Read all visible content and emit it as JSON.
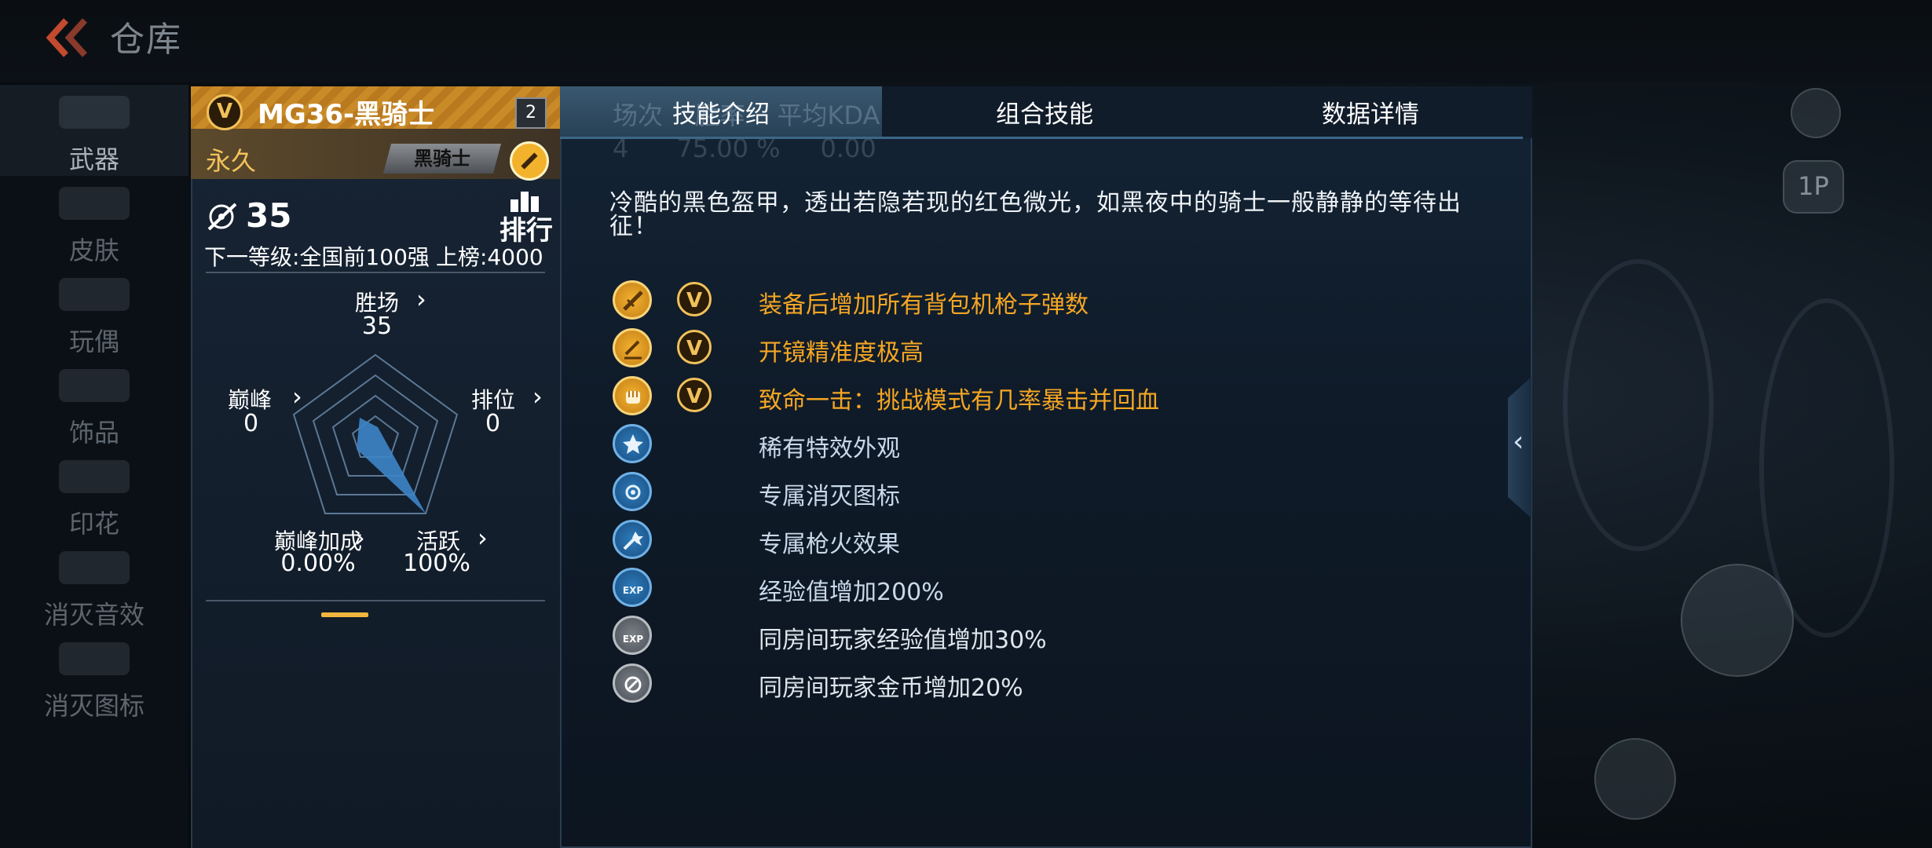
{
  "header": {
    "title": "仓库"
  },
  "nav": {
    "items": [
      {
        "label": "武器"
      },
      {
        "label": "皮肤"
      },
      {
        "label": "玩偶"
      },
      {
        "label": "饰品"
      },
      {
        "label": "印花"
      },
      {
        "label": "消灭音效"
      },
      {
        "label": "消灭图标"
      }
    ]
  },
  "weapon": {
    "name": "MG36-黑骑士",
    "badge_letter": "V",
    "level": "2",
    "duration": "永久",
    "tag": "黑骑士",
    "kill_count": "35",
    "rank_label": "排行",
    "next_level": "下一等级:全国前100强",
    "on_board": "上榜:4000"
  },
  "radar": {
    "top": {
      "label": "胜场",
      "value": "35"
    },
    "left": {
      "label": "巅峰",
      "value": "0"
    },
    "right": {
      "label": "排位",
      "value": "0"
    },
    "bottom_left": {
      "label": "巅峰加成",
      "value": "0.00%"
    },
    "bottom_right": {
      "label": "活跃",
      "value": "100%"
    }
  },
  "tabs": [
    {
      "label": "技能介绍"
    },
    {
      "label": "组合技能"
    },
    {
      "label": "数据详情"
    }
  ],
  "ghost_header": {
    "cols": "场次    胜率    平均KDA",
    "vals": "4      75.00 %     0.00"
  },
  "description": "冷酷的黑色盔甲，透出若隐若现的红色微光，如黑夜中的骑士一般静静的等待出征！",
  "skills": [
    {
      "text": "装备后增加所有背包机枪子弹数",
      "icon": "bullet-icon",
      "style": "gold",
      "vip": "V"
    },
    {
      "text": "开镜精准度极高",
      "icon": "scope-icon",
      "style": "gold",
      "vip": "V"
    },
    {
      "text": "致命一击：挑战模式有几率暴击并回血",
      "icon": "fist-icon",
      "style": "gold",
      "vip": "V"
    },
    {
      "text": "稀有特效外观",
      "icon": "star-icon",
      "style": "blue"
    },
    {
      "text": "专属消灭图标",
      "icon": "burst-icon",
      "style": "blue"
    },
    {
      "text": "专属枪火效果",
      "icon": "muzzle-flash-icon",
      "style": "blue"
    },
    {
      "text": "经验值增加200%",
      "icon": "exp-icon",
      "style": "blue"
    },
    {
      "text": "同房间玩家经验值增加30%",
      "icon": "team-exp-icon",
      "style": "grey"
    },
    {
      "text": "同房间玩家金币增加20%",
      "icon": "coin-icon",
      "style": "grey"
    }
  ],
  "hud": {
    "label_1p": "1P"
  },
  "colors": {
    "gold": "#f5a623",
    "accent_blue": "#3c6788",
    "active_tab": "#3a5870"
  }
}
